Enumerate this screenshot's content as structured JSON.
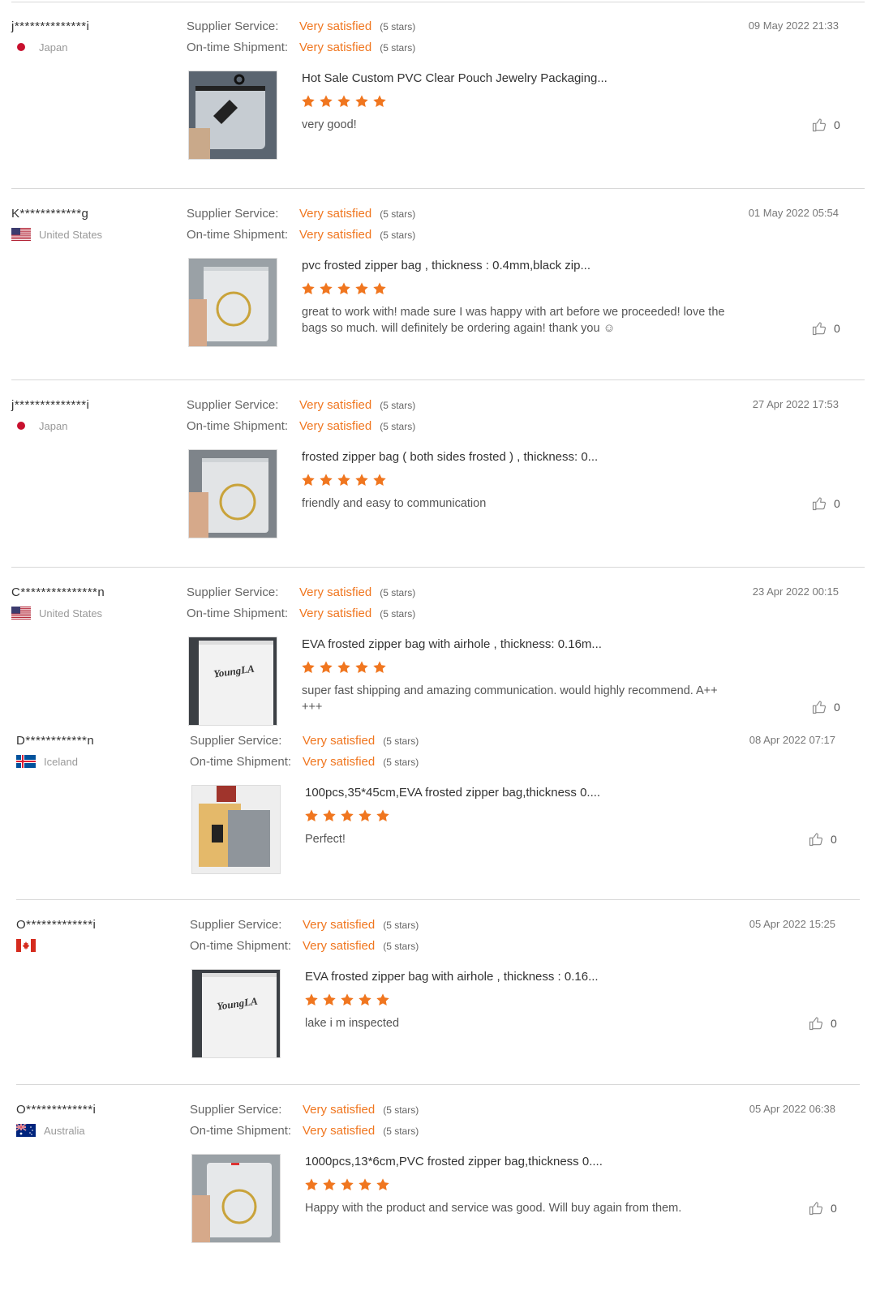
{
  "labels": {
    "supplier_service": "Supplier Service:",
    "on_time_shipment": "On-time Shipment:"
  },
  "colors": {
    "accent": "#f0761f",
    "star": "#f0761f",
    "divider": "#d8d8d8"
  },
  "reviews": [
    {
      "buyer": "j**************i",
      "country": "Japan",
      "flag_icon": "japan-flag-icon",
      "supplier_rating": "Very satisfied",
      "supplier_stars": "(5 stars)",
      "shipment_rating": "Very satisfied",
      "shipment_stars": "(5 stars)",
      "date": "09 May 2022 21:33",
      "product": "Hot Sale Custom PVC Clear Pouch Jewelry Packaging...",
      "rating_stars": 5,
      "comment": "very good!",
      "likes": "0"
    },
    {
      "buyer": "K************g",
      "country": "United States",
      "flag_icon": "us-flag-icon",
      "supplier_rating": "Very satisfied",
      "supplier_stars": "(5 stars)",
      "shipment_rating": "Very satisfied",
      "shipment_stars": "(5 stars)",
      "date": "01 May 2022 05:54",
      "product": "pvc frosted zipper bag ,  thickness :  0.4mm,black zip...",
      "rating_stars": 5,
      "comment": "great to work with! made sure I was happy with art before we proceeded!  love the bags so much.  will definitely be ordering again!  thank you ☺",
      "likes": "0"
    },
    {
      "buyer": "j**************i",
      "country": "Japan",
      "flag_icon": "japan-flag-icon",
      "supplier_rating": "Very satisfied",
      "supplier_stars": "(5 stars)",
      "shipment_rating": "Very satisfied",
      "shipment_stars": "(5 stars)",
      "date": "27 Apr 2022 17:53",
      "product": "frosted zipper bag ( both sides frosted ) , thickness: 0...",
      "rating_stars": 5,
      "comment": "friendly and easy to communication",
      "likes": "0"
    },
    {
      "buyer": "C***************n",
      "country": "United States",
      "flag_icon": "us-flag-icon",
      "supplier_rating": "Very satisfied",
      "supplier_stars": "(5 stars)",
      "shipment_rating": "Very satisfied",
      "shipment_stars": "(5 stars)",
      "date": "23 Apr 2022 00:15",
      "product": "EVA frosted zipper bag with airhole , thickness: 0.16m...",
      "rating_stars": 5,
      "comment": "super fast shipping and amazing communication. would highly recommend. A++ +++",
      "likes": "0"
    },
    {
      "buyer": "D************n",
      "country": "Iceland",
      "flag_icon": "iceland-flag-icon",
      "supplier_rating": "Very satisfied",
      "supplier_stars": "(5 stars)",
      "shipment_rating": "Very satisfied",
      "shipment_stars": "(5 stars)",
      "date": "08 Apr 2022 07:17",
      "product": "100pcs,35*45cm,EVA frosted zipper bag,thickness 0....",
      "rating_stars": 5,
      "comment": "Perfect!",
      "likes": "0"
    },
    {
      "buyer": "O*************i",
      "country": "",
      "flag_icon": "canada-flag-icon",
      "supplier_rating": "Very satisfied",
      "supplier_stars": "(5 stars)",
      "shipment_rating": "Very satisfied",
      "shipment_stars": "(5 stars)",
      "date": "05 Apr 2022 15:25",
      "product": "EVA frosted zipper bag with airhole , thickness : 0.16...",
      "rating_stars": 5,
      "comment": "lake i m inspected",
      "likes": "0"
    },
    {
      "buyer": "O*************i",
      "country": "Australia",
      "flag_icon": "australia-flag-icon",
      "supplier_rating": "Very satisfied",
      "supplier_stars": "(5 stars)",
      "shipment_rating": "Very satisfied",
      "shipment_stars": "(5 stars)",
      "date": "05 Apr 2022 06:38",
      "product": "1000pcs,13*6cm,PVC frosted zipper bag,thickness 0....",
      "rating_stars": 5,
      "comment": "Happy with the product and service was good. Will buy again from them.",
      "likes": "0"
    }
  ]
}
